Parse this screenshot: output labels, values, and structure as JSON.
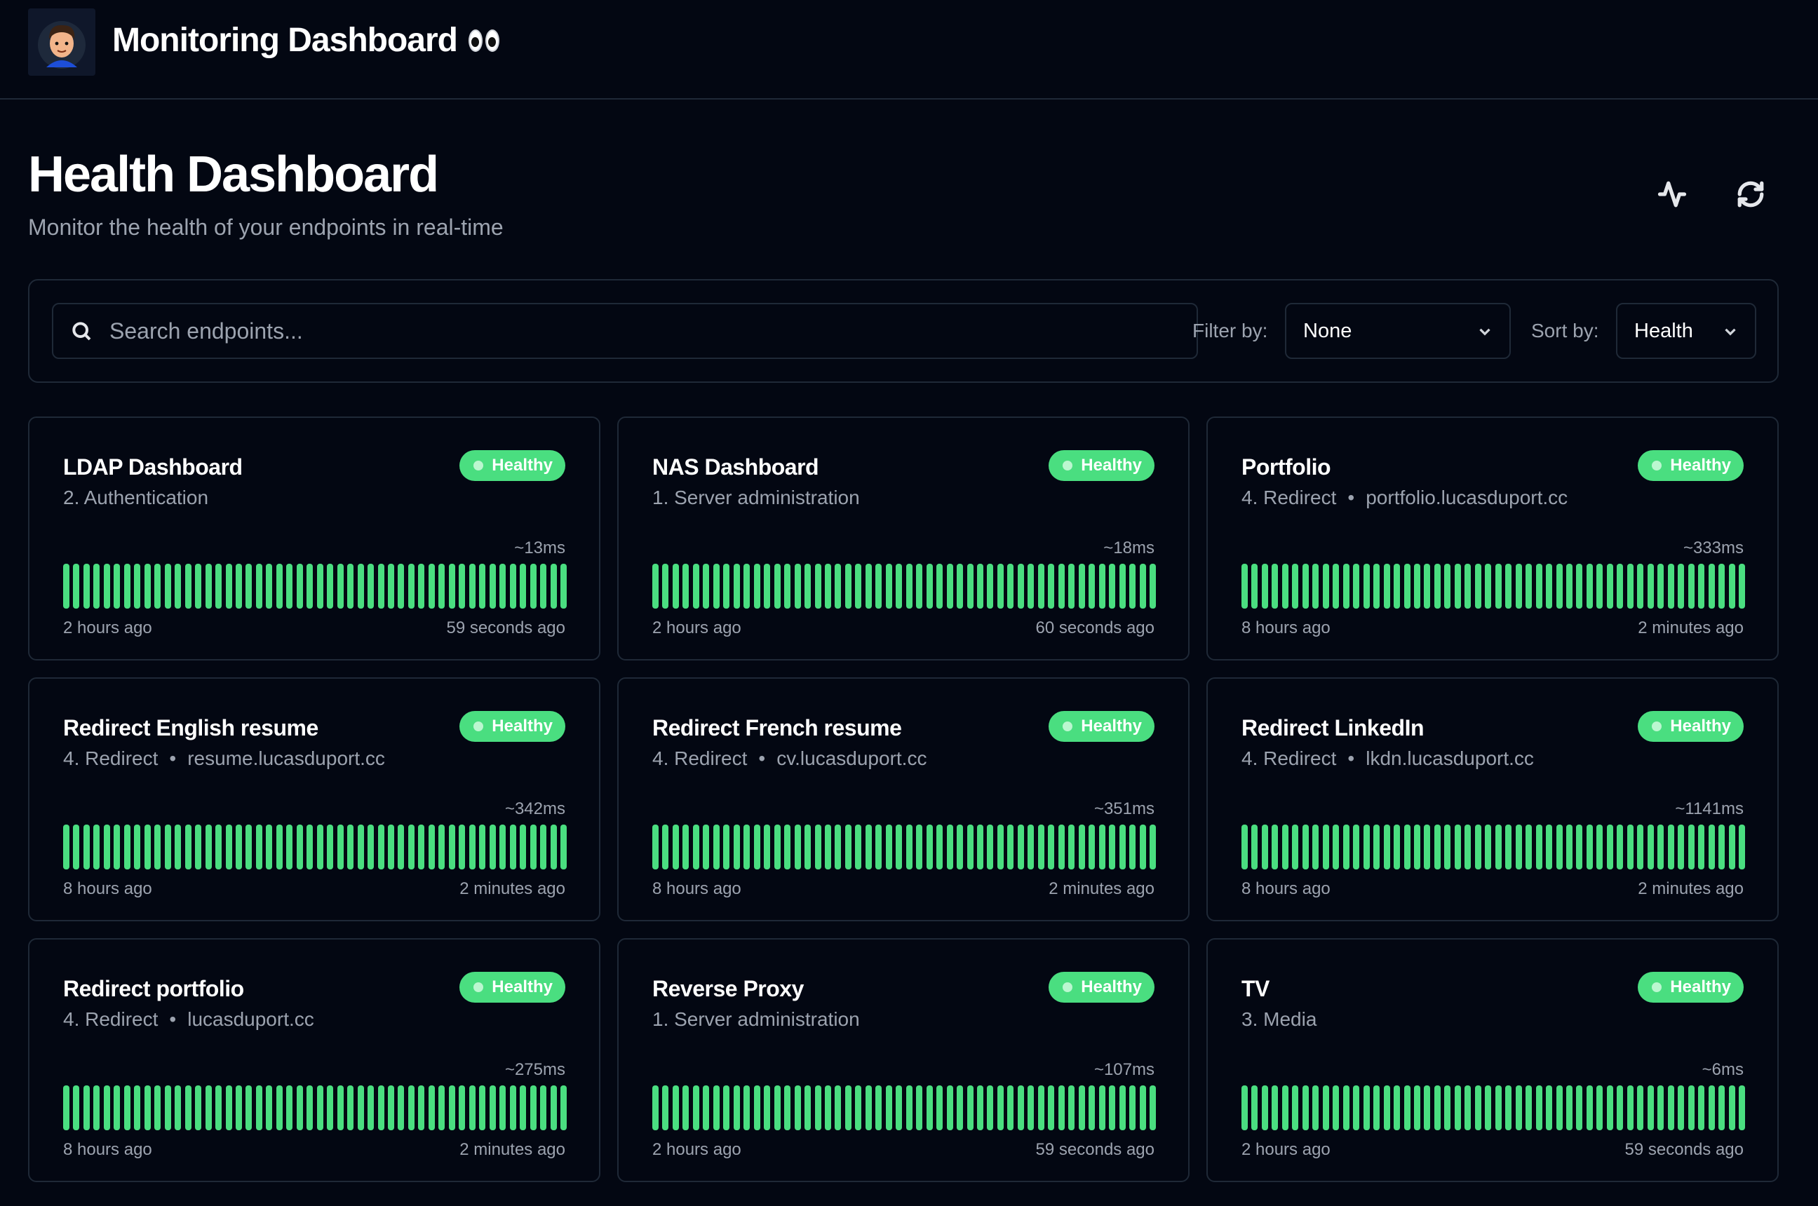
{
  "app": {
    "title": "Monitoring Dashboard"
  },
  "header": {
    "title": "Health Dashboard",
    "subtitle": "Monitor the health of your endpoints in real-time"
  },
  "toolbar": {
    "search_placeholder": "Search endpoints...",
    "filter_label": "Filter by:",
    "filter_value": "None",
    "sort_label": "Sort by:",
    "sort_value": "Health"
  },
  "colors": {
    "healthy": "#4ade80",
    "background": "#030712",
    "border": "#1f2937"
  },
  "endpoints": [
    {
      "name": "LDAP Dashboard",
      "group": "2. Authentication",
      "host": "",
      "status": "Healthy",
      "response_time": "~13ms",
      "oldest": "2 hours ago",
      "newest": "59 seconds ago",
      "checks": 50
    },
    {
      "name": "NAS Dashboard",
      "group": "1. Server administration",
      "host": "",
      "status": "Healthy",
      "response_time": "~18ms",
      "oldest": "2 hours ago",
      "newest": "60 seconds ago",
      "checks": 50
    },
    {
      "name": "Portfolio",
      "group": "4. Redirect",
      "host": "portfolio.lucasduport.cc",
      "status": "Healthy",
      "response_time": "~333ms",
      "oldest": "8 hours ago",
      "newest": "2 minutes ago",
      "checks": 50
    },
    {
      "name": "Redirect English resume",
      "group": "4. Redirect",
      "host": "resume.lucasduport.cc",
      "status": "Healthy",
      "response_time": "~342ms",
      "oldest": "8 hours ago",
      "newest": "2 minutes ago",
      "checks": 50
    },
    {
      "name": "Redirect French resume",
      "group": "4. Redirect",
      "host": "cv.lucasduport.cc",
      "status": "Healthy",
      "response_time": "~351ms",
      "oldest": "8 hours ago",
      "newest": "2 minutes ago",
      "checks": 50
    },
    {
      "name": "Redirect LinkedIn",
      "group": "4. Redirect",
      "host": "lkdn.lucasduport.cc",
      "status": "Healthy",
      "response_time": "~1141ms",
      "oldest": "8 hours ago",
      "newest": "2 minutes ago",
      "checks": 50
    },
    {
      "name": "Redirect portfolio",
      "group": "4. Redirect",
      "host": "lucasduport.cc",
      "status": "Healthy",
      "response_time": "~275ms",
      "oldest": "8 hours ago",
      "newest": "2 minutes ago",
      "checks": 50
    },
    {
      "name": "Reverse Proxy",
      "group": "1. Server administration",
      "host": "",
      "status": "Healthy",
      "response_time": "~107ms",
      "oldest": "2 hours ago",
      "newest": "59 seconds ago",
      "checks": 50
    },
    {
      "name": "TV",
      "group": "3. Media",
      "host": "",
      "status": "Healthy",
      "response_time": "~6ms",
      "oldest": "2 hours ago",
      "newest": "59 seconds ago",
      "checks": 50
    }
  ]
}
